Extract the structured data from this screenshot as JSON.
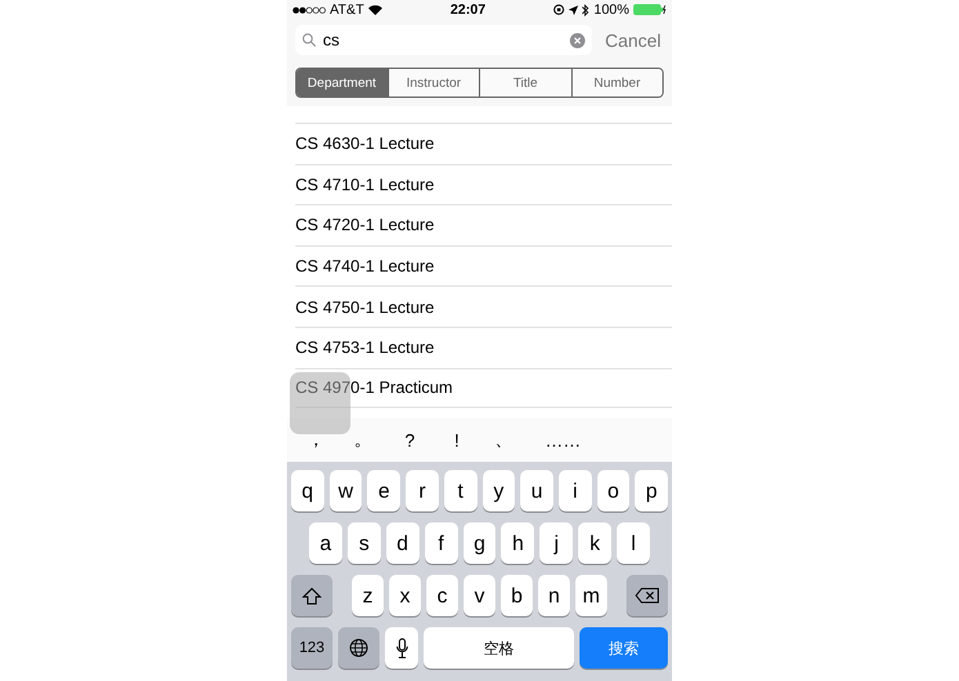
{
  "status_bar": {
    "carrier": "AT&T",
    "time": "22:07",
    "battery": "100%"
  },
  "search": {
    "value": "cs",
    "cancel": "Cancel"
  },
  "segments": [
    {
      "label": "Department",
      "selected": true
    },
    {
      "label": "Instructor",
      "selected": false
    },
    {
      "label": "Title",
      "selected": false
    },
    {
      "label": "Number",
      "selected": false
    }
  ],
  "rows": [
    "CS 4630-1 Lecture",
    "CS 4710-1 Lecture",
    "CS 4720-1 Lecture",
    "CS 4740-1 Lecture",
    "CS 4750-1 Lecture",
    "CS 4753-1 Lecture",
    "CS 4970-1 Practicum"
  ],
  "candidates": [
    "，",
    "。",
    "?",
    "!",
    "、",
    "……"
  ],
  "keyboard": {
    "rows": [
      [
        "q",
        "w",
        "e",
        "r",
        "t",
        "y",
        "u",
        "i",
        "o",
        "p"
      ],
      [
        "a",
        "s",
        "d",
        "f",
        "g",
        "h",
        "j",
        "k",
        "l"
      ],
      [
        "z",
        "x",
        "c",
        "v",
        "b",
        "n",
        "m"
      ]
    ],
    "numbers": "123",
    "space": "空格",
    "search": "搜索"
  }
}
